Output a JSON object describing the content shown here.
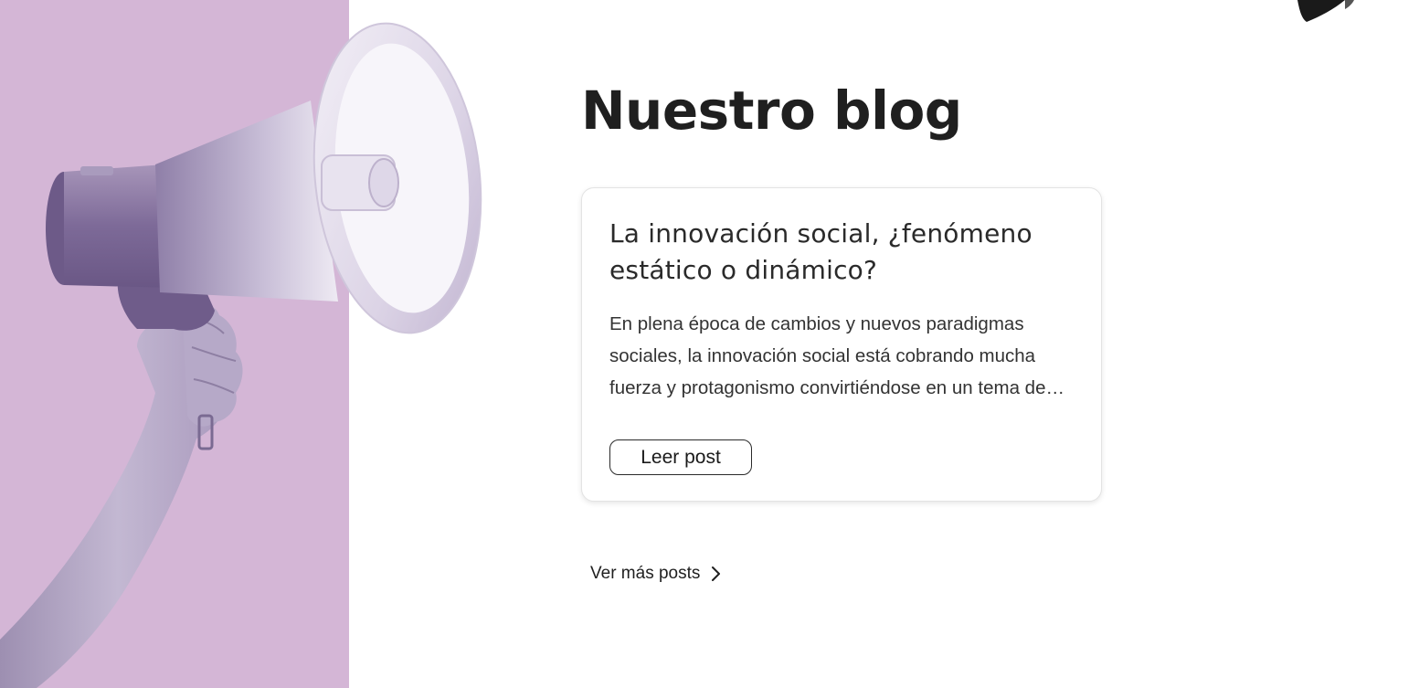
{
  "blog": {
    "title": "Nuestro blog"
  },
  "post": {
    "title": "La innovación social, ¿fenómeno estático o dinámico?",
    "excerpt": "En plena época de cambios y nuevos paradigmas sociales, la innovación social está cobrando mucha fuerza y protagonismo convirtiéndose en un tema de debate cada vez más presente.",
    "button_label": "Leer post"
  },
  "more": {
    "label": "Ver más posts",
    "icon": "chevron-right-icon"
  },
  "colors": {
    "panel": "#d4b6d6",
    "megaphone": "#8e7aa6",
    "text": "#1f1f1f",
    "card_border": "#e3e3e3"
  }
}
